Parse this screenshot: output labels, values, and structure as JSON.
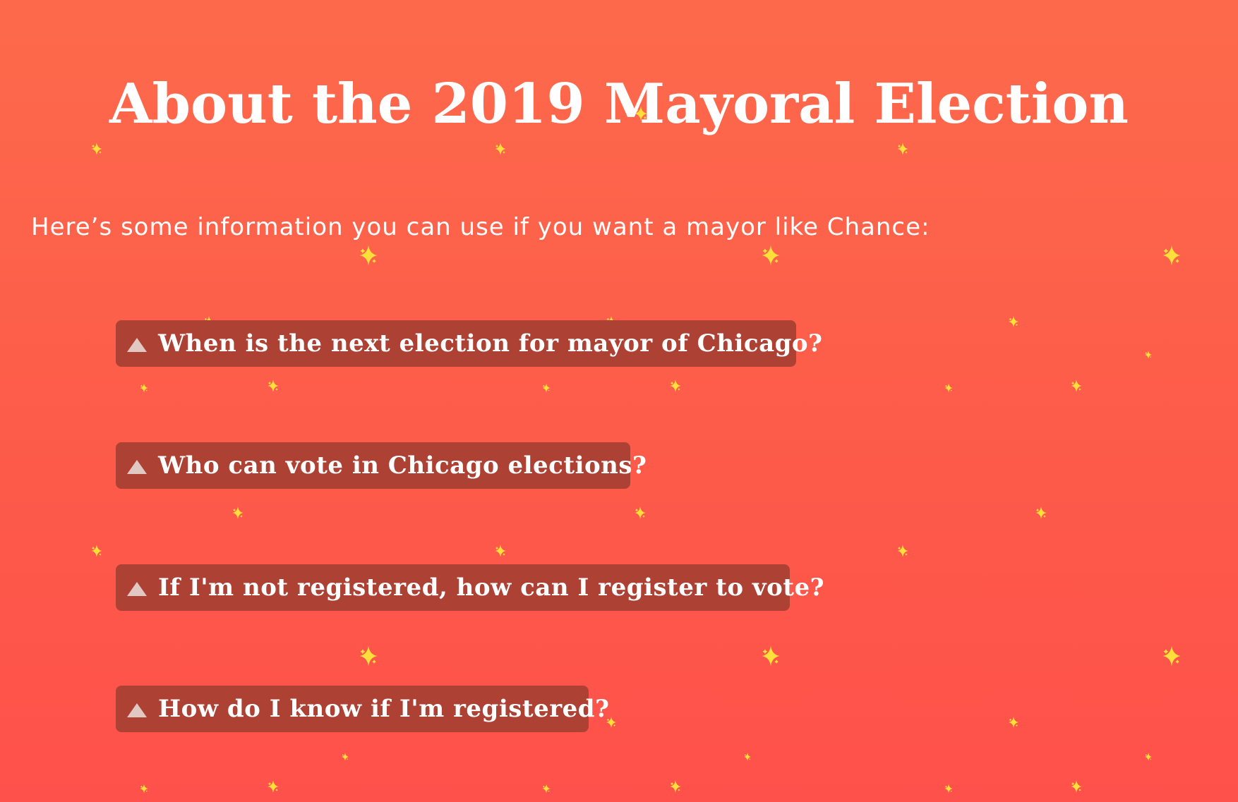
{
  "page": {
    "title": "About the 2019 Mayoral Election",
    "intro": "Here’s some information you can use if you want a mayor like Chance:"
  },
  "faq": [
    {
      "question": "When is the next election for mayor of Chicago?",
      "icon": "triangle-up-icon"
    },
    {
      "question": "Who can vote in Chicago elections?",
      "icon": "triangle-up-icon"
    },
    {
      "question": "If I'm not registered, how can I register to vote?",
      "icon": "triangle-up-icon"
    },
    {
      "question": "How do I know if I'm registered?",
      "icon": "triangle-up-icon"
    }
  ],
  "colors": {
    "background_top": "#fd6a4b",
    "background_bottom": "#fe514b",
    "faq_button": "#ad4134",
    "sparkle": "#ffd93a",
    "text": "#ffffff"
  },
  "decorations": {
    "background_icon": "sparkle-icon"
  }
}
